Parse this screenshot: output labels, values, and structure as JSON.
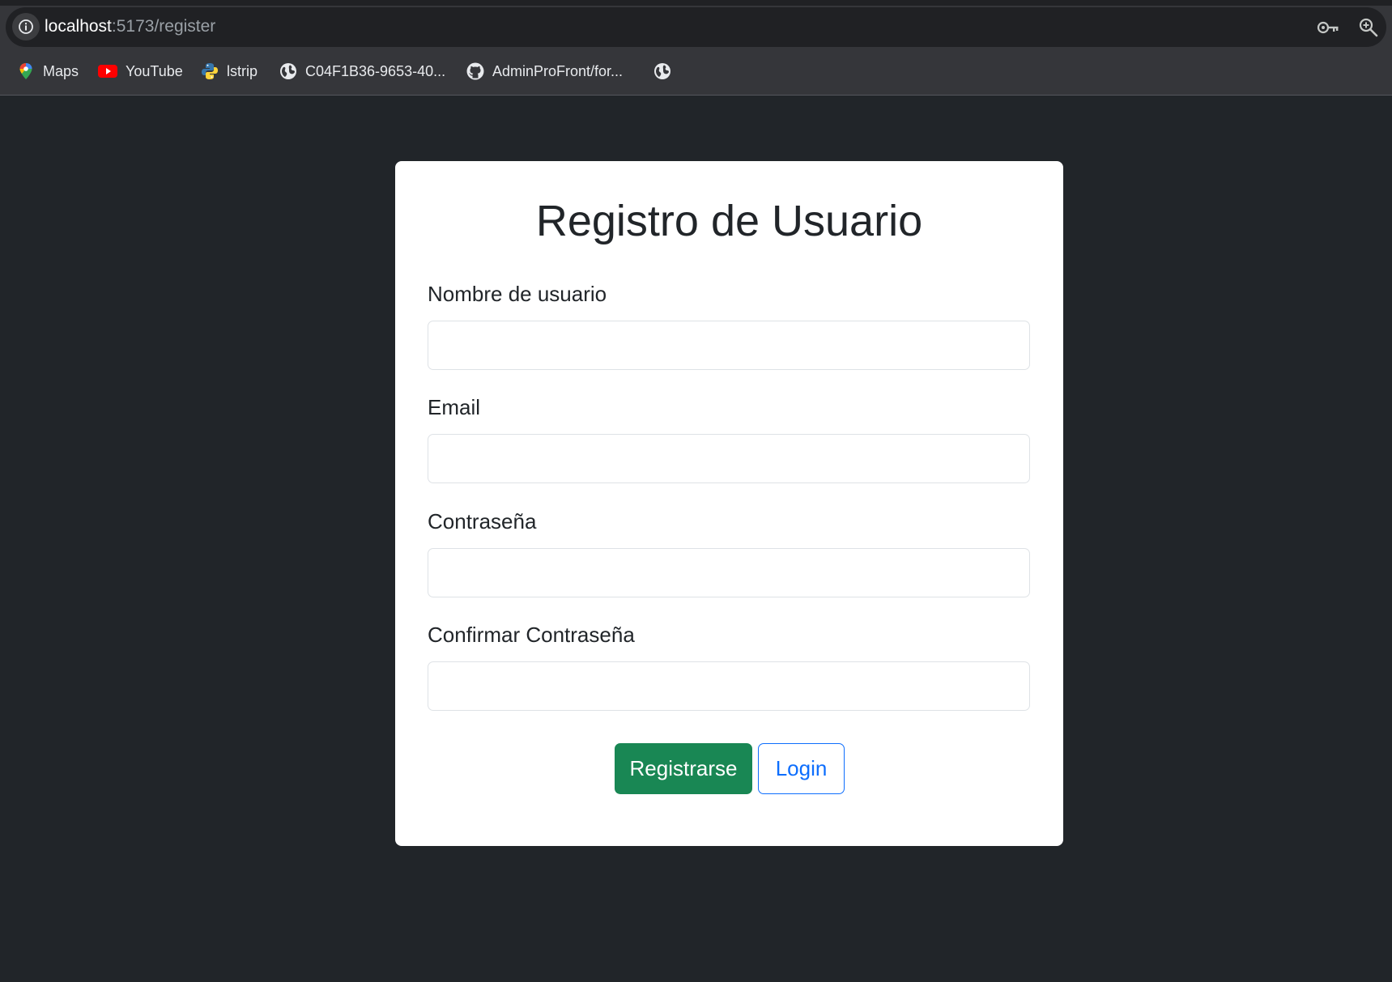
{
  "browser": {
    "url_host": "localhost",
    "url_rest": ":5173/register",
    "icons": {
      "info": "info-icon",
      "password_key": "key-icon",
      "zoom": "zoom-in-icon"
    },
    "bookmarks": [
      {
        "label": "Maps",
        "icon": "google-maps-icon"
      },
      {
        "label": "YouTube",
        "icon": "youtube-icon"
      },
      {
        "label": "lstrip",
        "icon": "python-icon"
      },
      {
        "label": "C04F1B36-9653-40...",
        "icon": "globe-icon"
      },
      {
        "label": "AdminProFront/for...",
        "icon": "github-icon"
      },
      {
        "label": "",
        "icon": "globe-icon"
      }
    ]
  },
  "form": {
    "title": "Registro de Usuario",
    "fields": [
      {
        "label": "Nombre de usuario",
        "value": "",
        "type": "text"
      },
      {
        "label": "Email",
        "value": "",
        "type": "email"
      },
      {
        "label": "Contraseña",
        "value": "",
        "type": "password"
      },
      {
        "label": "Confirmar Contraseña",
        "value": "",
        "type": "password"
      }
    ],
    "submit_label": "Registrarse",
    "login_label": "Login"
  },
  "colors": {
    "page_background": "#212529",
    "card_background": "#ffffff",
    "success": "#198754",
    "primary": "#0d6efd"
  }
}
